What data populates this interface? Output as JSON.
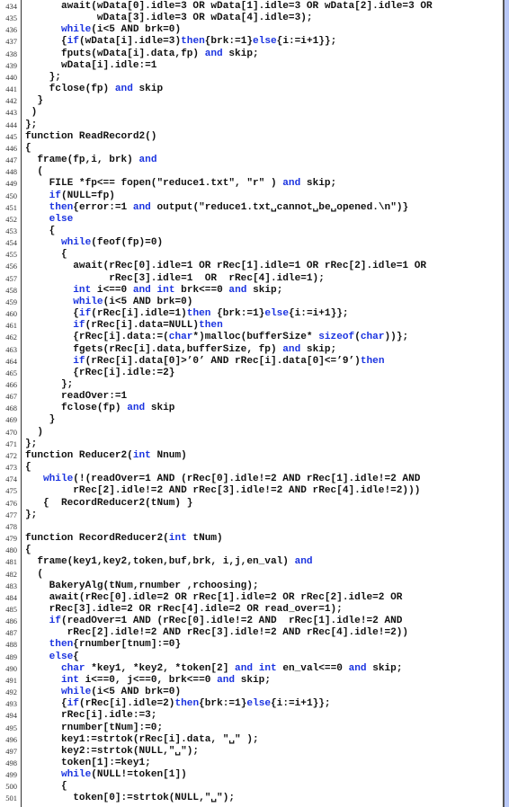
{
  "document": {
    "keyword_color": "#1a33e0",
    "lines": [
      {
        "n": "434",
        "segs": [
          [
            "      await(wData[0].idle=3 OR wData[1].idle=3 OR wData[2].idle=3 OR",
            ""
          ]
        ]
      },
      {
        "n": "435",
        "segs": [
          [
            "            wData[3].idle=3 OR wData[4].idle=3);",
            ""
          ]
        ]
      },
      {
        "n": "436",
        "segs": [
          [
            "      ",
            ""
          ],
          [
            "while",
            "kw"
          ],
          [
            "(i<5 AND brk=0)",
            ""
          ]
        ]
      },
      {
        "n": "437",
        "segs": [
          [
            "      {",
            ""
          ],
          [
            "if",
            "kw"
          ],
          [
            "(wData[i].idle=3)",
            ""
          ],
          [
            "then",
            "kw"
          ],
          [
            "{brk:=1}",
            ""
          ],
          [
            "else",
            "kw"
          ],
          [
            "{i:=i+1}};",
            ""
          ]
        ]
      },
      {
        "n": "438",
        "segs": [
          [
            "      fputs(wData[i].data,fp) ",
            ""
          ],
          [
            "and",
            "kw"
          ],
          [
            " skip;",
            ""
          ]
        ]
      },
      {
        "n": "439",
        "segs": [
          [
            "      wData[i].idle:=1",
            ""
          ]
        ]
      },
      {
        "n": "440",
        "segs": [
          [
            "    };",
            ""
          ]
        ]
      },
      {
        "n": "441",
        "segs": [
          [
            "    fclose(fp) ",
            ""
          ],
          [
            "and",
            "kw"
          ],
          [
            " skip",
            ""
          ]
        ]
      },
      {
        "n": "442",
        "segs": [
          [
            "  }",
            ""
          ]
        ]
      },
      {
        "n": "443",
        "segs": [
          [
            " )",
            ""
          ]
        ]
      },
      {
        "n": "444",
        "segs": [
          [
            "};",
            ""
          ]
        ]
      },
      {
        "n": "445",
        "segs": [
          [
            "function ReadRecord2()",
            ""
          ]
        ]
      },
      {
        "n": "446",
        "segs": [
          [
            "{",
            ""
          ]
        ]
      },
      {
        "n": "447",
        "segs": [
          [
            "  frame(fp,i, brk) ",
            ""
          ],
          [
            "and",
            "kw"
          ]
        ]
      },
      {
        "n": "448",
        "segs": [
          [
            "  (",
            ""
          ]
        ]
      },
      {
        "n": "449",
        "segs": [
          [
            "    FILE *fp<== fopen(\"reduce1.txt\", \"r\" ) ",
            ""
          ],
          [
            "and",
            "kw"
          ],
          [
            " skip;",
            ""
          ]
        ]
      },
      {
        "n": "450",
        "segs": [
          [
            "    ",
            ""
          ],
          [
            "if",
            "kw"
          ],
          [
            "(NULL=fp)",
            ""
          ]
        ]
      },
      {
        "n": "451",
        "segs": [
          [
            "    ",
            ""
          ],
          [
            "then",
            "kw"
          ],
          [
            "{error:=1 ",
            ""
          ],
          [
            "and",
            "kw"
          ],
          [
            " output(\"reduce1.txt␣cannot␣be␣opened.\\n\")}",
            ""
          ]
        ]
      },
      {
        "n": "452",
        "segs": [
          [
            "    ",
            ""
          ],
          [
            "else",
            "kw"
          ]
        ]
      },
      {
        "n": "453",
        "segs": [
          [
            "    {",
            ""
          ]
        ]
      },
      {
        "n": "454",
        "segs": [
          [
            "      ",
            ""
          ],
          [
            "while",
            "kw"
          ],
          [
            "(feof(fp)=0)",
            ""
          ]
        ]
      },
      {
        "n": "455",
        "segs": [
          [
            "      {",
            ""
          ]
        ]
      },
      {
        "n": "456",
        "segs": [
          [
            "        await(rRec[0].idle=1 OR rRec[1].idle=1 OR rRec[2].idle=1 OR",
            ""
          ]
        ]
      },
      {
        "n": "457",
        "segs": [
          [
            "              rRec[3].idle=1  OR  rRec[4].idle=1);",
            ""
          ]
        ]
      },
      {
        "n": "458",
        "segs": [
          [
            "        ",
            ""
          ],
          [
            "int",
            "kw"
          ],
          [
            " i<==0 ",
            ""
          ],
          [
            "and",
            "kw"
          ],
          [
            " ",
            ""
          ],
          [
            "int",
            "kw"
          ],
          [
            " brk<==0 ",
            ""
          ],
          [
            "and",
            "kw"
          ],
          [
            " skip;",
            ""
          ]
        ]
      },
      {
        "n": "459",
        "segs": [
          [
            "        ",
            ""
          ],
          [
            "while",
            "kw"
          ],
          [
            "(i<5 AND brk=0)",
            ""
          ]
        ]
      },
      {
        "n": "460",
        "segs": [
          [
            "        {",
            ""
          ],
          [
            "if",
            "kw"
          ],
          [
            "(rRec[i].idle=1)",
            ""
          ],
          [
            "then",
            "kw"
          ],
          [
            " {brk:=1}",
            ""
          ],
          [
            "else",
            "kw"
          ],
          [
            "{i:=i+1}};",
            ""
          ]
        ]
      },
      {
        "n": "461",
        "segs": [
          [
            "        ",
            ""
          ],
          [
            "if",
            "kw"
          ],
          [
            "(rRec[i].data=NULL)",
            ""
          ],
          [
            "then",
            "kw"
          ]
        ]
      },
      {
        "n": "462",
        "segs": [
          [
            "        {rRec[i].data:=(",
            ""
          ],
          [
            "char",
            "kw"
          ],
          [
            "*)malloc(bufferSize* ",
            ""
          ],
          [
            "sizeof",
            "kw"
          ],
          [
            "(",
            ""
          ],
          [
            "char",
            "kw"
          ],
          [
            "))};",
            ""
          ]
        ]
      },
      {
        "n": "463",
        "segs": [
          [
            "        fgets(rRec[i].data,bufferSize, fp) ",
            ""
          ],
          [
            "and",
            "kw"
          ],
          [
            " skip;",
            ""
          ]
        ]
      },
      {
        "n": "464",
        "segs": [
          [
            "        ",
            ""
          ],
          [
            "if",
            "kw"
          ],
          [
            "(rRec[i].data[0]>’0’ AND rRec[i].data[0]<=’9’)",
            ""
          ],
          [
            "then",
            "kw"
          ]
        ]
      },
      {
        "n": "465",
        "segs": [
          [
            "        {rRec[i].idle:=2}",
            ""
          ]
        ]
      },
      {
        "n": "466",
        "segs": [
          [
            "      };",
            ""
          ]
        ]
      },
      {
        "n": "467",
        "segs": [
          [
            "      readOver:=1",
            ""
          ]
        ]
      },
      {
        "n": "468",
        "segs": [
          [
            "      fclose(fp) ",
            ""
          ],
          [
            "and",
            "kw"
          ],
          [
            " skip",
            ""
          ]
        ]
      },
      {
        "n": "469",
        "segs": [
          [
            "    }",
            ""
          ]
        ]
      },
      {
        "n": "470",
        "segs": [
          [
            "  )",
            ""
          ]
        ]
      },
      {
        "n": "471",
        "segs": [
          [
            "};",
            ""
          ]
        ]
      },
      {
        "n": "472",
        "segs": [
          [
            "function Reducer2(",
            ""
          ],
          [
            "int",
            "kw"
          ],
          [
            " Nnum)",
            ""
          ]
        ]
      },
      {
        "n": "473",
        "segs": [
          [
            "{",
            ""
          ]
        ]
      },
      {
        "n": "474",
        "segs": [
          [
            "   ",
            ""
          ],
          [
            "while",
            "kw"
          ],
          [
            "(!(readOver=1 AND (rRec[0].idle!=2 AND rRec[1].idle!=2 AND",
            ""
          ]
        ]
      },
      {
        "n": "475",
        "segs": [
          [
            "        rRec[2].idle!=2 AND rRec[3].idle!=2 AND rRec[4].idle!=2)))",
            ""
          ]
        ]
      },
      {
        "n": "476",
        "segs": [
          [
            "   {  RecordReducer2(tNum) }",
            ""
          ]
        ]
      },
      {
        "n": "477",
        "segs": [
          [
            "};",
            ""
          ]
        ]
      },
      {
        "n": "478",
        "segs": [
          [
            "",
            ""
          ]
        ]
      },
      {
        "n": "479",
        "segs": [
          [
            "function RecordReducer2(",
            ""
          ],
          [
            "int",
            "kw"
          ],
          [
            " tNum)",
            ""
          ]
        ]
      },
      {
        "n": "480",
        "segs": [
          [
            "{",
            ""
          ]
        ]
      },
      {
        "n": "481",
        "segs": [
          [
            "  frame(key1,key2,token,buf,brk, i,j,en_val) ",
            ""
          ],
          [
            "and",
            "kw"
          ]
        ]
      },
      {
        "n": "482",
        "segs": [
          [
            "  (",
            ""
          ]
        ]
      },
      {
        "n": "483",
        "segs": [
          [
            "    BakeryAlg(tNum,rnumber ,rchoosing);",
            ""
          ]
        ]
      },
      {
        "n": "484",
        "segs": [
          [
            "    await(rRec[0].idle=2 OR rRec[1].idle=2 OR rRec[2].idle=2 OR",
            ""
          ]
        ]
      },
      {
        "n": "485",
        "segs": [
          [
            "    rRec[3].idle=2 OR rRec[4].idle=2 OR read_over=1);",
            ""
          ]
        ]
      },
      {
        "n": "486",
        "segs": [
          [
            "    ",
            ""
          ],
          [
            "if",
            "kw"
          ],
          [
            "(readOver=1 AND (rRec[0].idle!=2 AND  rRec[1].idle!=2 AND",
            ""
          ]
        ]
      },
      {
        "n": "487",
        "segs": [
          [
            "       rRec[2].idle!=2 AND rRec[3].idle!=2 AND rRec[4].idle!=2))",
            ""
          ]
        ]
      },
      {
        "n": "488",
        "segs": [
          [
            "    ",
            ""
          ],
          [
            "then",
            "kw"
          ],
          [
            "{rnumber[tnum]:=0}",
            ""
          ]
        ]
      },
      {
        "n": "489",
        "segs": [
          [
            "    ",
            ""
          ],
          [
            "else",
            "kw"
          ],
          [
            "{",
            ""
          ]
        ]
      },
      {
        "n": "490",
        "segs": [
          [
            "      ",
            ""
          ],
          [
            "char",
            "kw"
          ],
          [
            " *key1, *key2, *token[2] ",
            ""
          ],
          [
            "and",
            "kw"
          ],
          [
            " ",
            ""
          ],
          [
            "int",
            "kw"
          ],
          [
            " en_val<==0 ",
            ""
          ],
          [
            "and",
            "kw"
          ],
          [
            " skip;",
            ""
          ]
        ]
      },
      {
        "n": "491",
        "segs": [
          [
            "      ",
            ""
          ],
          [
            "int",
            "kw"
          ],
          [
            " i<==0, j<==0, brk<==0 ",
            ""
          ],
          [
            "and",
            "kw"
          ],
          [
            " skip;",
            ""
          ]
        ]
      },
      {
        "n": "492",
        "segs": [
          [
            "      ",
            ""
          ],
          [
            "while",
            "kw"
          ],
          [
            "(i<5 AND brk=0)",
            ""
          ]
        ]
      },
      {
        "n": "493",
        "segs": [
          [
            "      {",
            ""
          ],
          [
            "if",
            "kw"
          ],
          [
            "(rRec[i].idle=2)",
            ""
          ],
          [
            "then",
            "kw"
          ],
          [
            "{brk:=1}",
            ""
          ],
          [
            "else",
            "kw"
          ],
          [
            "{i:=i+1}};",
            ""
          ]
        ]
      },
      {
        "n": "494",
        "segs": [
          [
            "      rRec[i].idle:=3;",
            ""
          ]
        ]
      },
      {
        "n": "495",
        "segs": [
          [
            "      rnumber[tNum]:=0;",
            ""
          ]
        ]
      },
      {
        "n": "496",
        "segs": [
          [
            "      key1:=strtok(rRec[i].data, \"␣\" );",
            ""
          ]
        ]
      },
      {
        "n": "497",
        "segs": [
          [
            "      key2:=strtok(NULL,\"␣\");",
            ""
          ]
        ]
      },
      {
        "n": "498",
        "segs": [
          [
            "      token[1]:=key1;",
            ""
          ]
        ]
      },
      {
        "n": "499",
        "segs": [
          [
            "      ",
            ""
          ],
          [
            "while",
            "kw"
          ],
          [
            "(NULL!=token[1])",
            ""
          ]
        ]
      },
      {
        "n": "500",
        "segs": [
          [
            "      {",
            ""
          ]
        ]
      },
      {
        "n": "501",
        "segs": [
          [
            "        token[0]:=strtok(NULL,\"␣\");",
            ""
          ]
        ]
      }
    ]
  }
}
